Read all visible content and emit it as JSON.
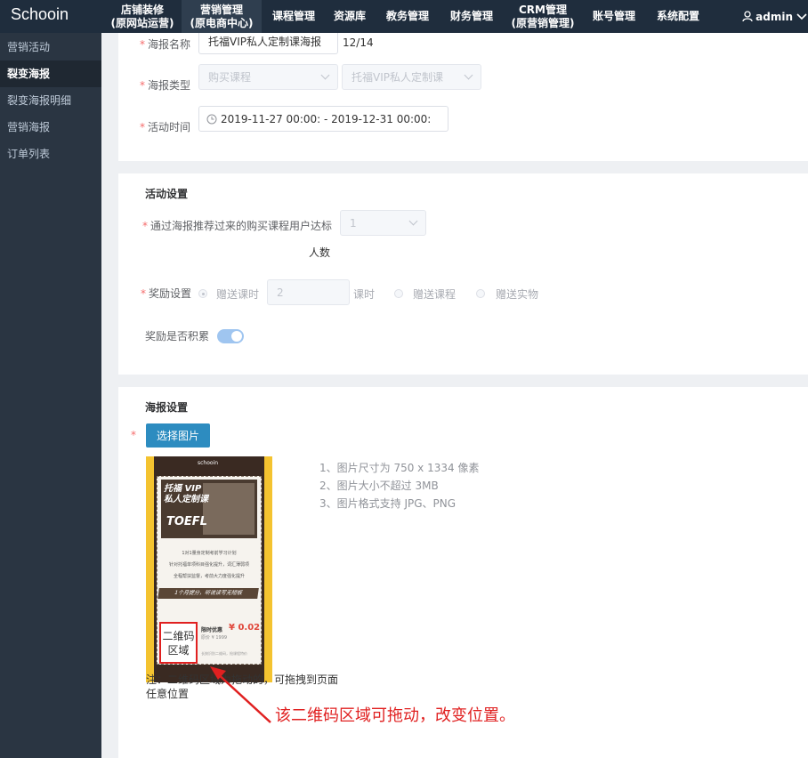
{
  "app": {
    "logo": "Schooin"
  },
  "nav": [
    {
      "line1": "店铺装修",
      "line2": "(原网站运营)"
    },
    {
      "line1": "营销管理",
      "line2": "(原电商中心)"
    },
    {
      "line1": "课程管理",
      "line2": ""
    },
    {
      "line1": "资源库",
      "line2": ""
    },
    {
      "line1": "教务管理",
      "line2": ""
    },
    {
      "line1": "财务管理",
      "line2": ""
    },
    {
      "line1": "CRM管理",
      "line2": "(原营销管理)"
    },
    {
      "line1": "账号管理",
      "line2": ""
    },
    {
      "line1": "系统配置",
      "line2": ""
    }
  ],
  "user": {
    "name": "admin"
  },
  "sidebar": {
    "items": [
      {
        "label": "营销活动"
      },
      {
        "label": "裂变海报"
      },
      {
        "label": "裂变海报明细"
      },
      {
        "label": "营销海报"
      },
      {
        "label": "订单列表"
      }
    ]
  },
  "basic": {
    "name_label": "海报名称",
    "name_value": "托福VIP私人定制课海报",
    "name_count": "12/14",
    "type_label": "海报类型",
    "type_value": "购买课程",
    "course_value": "托福VIP私人定制课",
    "time_label": "活动时间",
    "time_value": "2019-11-27 00:00: - 2019-12-31 00:00:"
  },
  "activity": {
    "title": "活动设置",
    "threshold_label": "通过海报推荐过来的购买课程用户达标",
    "threshold_unit": "人数",
    "threshold_value": "1",
    "reward_label": "奖励设置",
    "reward_option1": "赠送课时",
    "reward_hours": "2",
    "reward_hours_unit": "课时",
    "reward_option2": "赠送课程",
    "reward_option3": "赠送实物",
    "accumulate_label": "奖励是否积累",
    "accumulate_on": true
  },
  "poster": {
    "title": "海报设置",
    "select_button": "选择图片",
    "brand": "schooin",
    "headline1": "托福 VIP",
    "headline2": "私人定制课",
    "headline3": "TOEFL",
    "desc1": "1对1量身定制考前学习计划",
    "desc2": "针对托福单项科目强化提升，词汇薄弱项",
    "desc3": "全程帮扶监督，考前大力度强化提升",
    "band": "1个月提分，听说读写无短板",
    "qr_label": "二维码区域",
    "price_label": "限时优惠",
    "price_value": "¥ 0.02",
    "price_orig": "原价 ¥ 1999",
    "price_note": "长按识别二维码，抢课程特价",
    "hints": [
      "1、图片尺寸为 750 x 1334 像素",
      "2、图片大小不超过 3MB",
      "3、图片格式支持 JPG、PNG"
    ],
    "note_line1": "注：二维码区域为拖动的，可拖拽到页面",
    "note_line2": "任意位置",
    "annotation": "该二维码区域可拖动，改变位置。"
  },
  "colors": {
    "topbar": "#1f2d3d",
    "sidebar": "#2a3542",
    "primary": "#2d8cc0",
    "annotation": "#e02020"
  }
}
